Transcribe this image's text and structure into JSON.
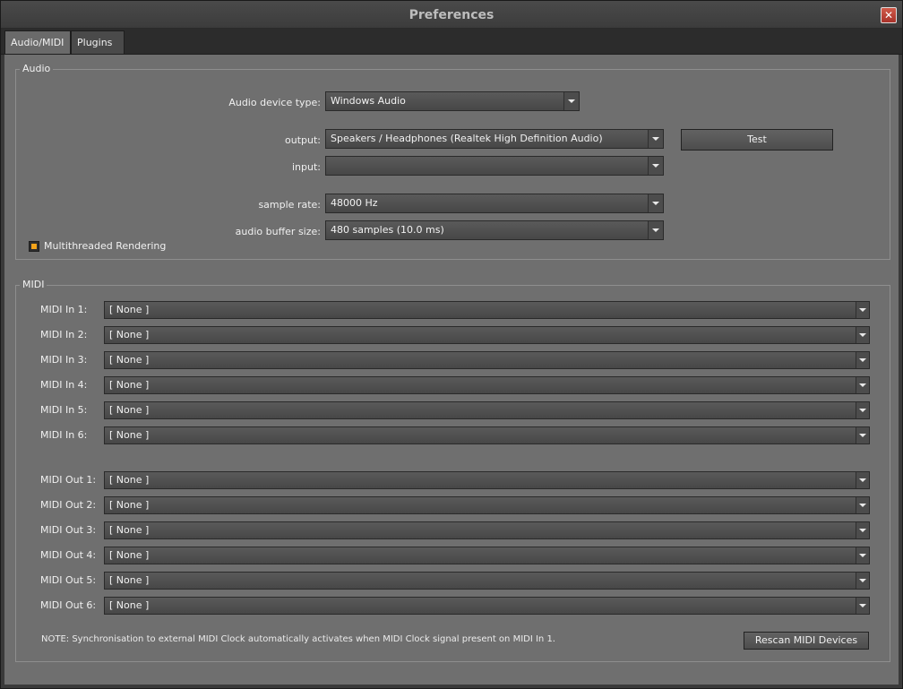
{
  "window": {
    "title": "Preferences",
    "close_glyph": "✕"
  },
  "tabs": [
    {
      "label": "Audio/MIDI",
      "active": true
    },
    {
      "label": "Plugins",
      "active": false
    }
  ],
  "audio": {
    "group_label": "Audio",
    "device_type_label": "Audio device type:",
    "device_type_value": "Windows Audio",
    "output_label": "output:",
    "output_value": "Speakers / Headphones (Realtek High Definition Audio)",
    "test_label": "Test",
    "input_label": "input:",
    "input_value": "",
    "sample_rate_label": "sample rate:",
    "sample_rate_value": "48000 Hz",
    "buffer_label": "audio buffer size:",
    "buffer_value": "480 samples (10.0 ms)",
    "multithread_label": "Multithreaded Rendering",
    "multithread_checked": true,
    "accent_color": "#f2a31a"
  },
  "midi": {
    "group_label": "MIDI",
    "inputs": [
      {
        "label": "MIDI In 1:",
        "value": "[ None ]"
      },
      {
        "label": "MIDI In 2:",
        "value": "[ None ]"
      },
      {
        "label": "MIDI In 3:",
        "value": "[ None ]"
      },
      {
        "label": "MIDI In 4:",
        "value": "[ None ]"
      },
      {
        "label": "MIDI In 5:",
        "value": "[ None ]"
      },
      {
        "label": "MIDI In 6:",
        "value": "[ None ]"
      }
    ],
    "outputs": [
      {
        "label": "MIDI Out 1:",
        "value": "[ None ]"
      },
      {
        "label": "MIDI Out 2:",
        "value": "[ None ]"
      },
      {
        "label": "MIDI Out 3:",
        "value": "[ None ]"
      },
      {
        "label": "MIDI Out 4:",
        "value": "[ None ]"
      },
      {
        "label": "MIDI Out 5:",
        "value": "[ None ]"
      },
      {
        "label": "MIDI Out 6:",
        "value": "[ None ]"
      }
    ],
    "note": "NOTE: Synchronisation to external MIDI Clock automatically activates when MIDI Clock signal present on MIDI In 1.",
    "rescan_label": "Rescan MIDI Devices"
  },
  "icons": {
    "close": "close-icon",
    "dropdown": "chevron-down-icon",
    "checkbox": "checkbox-icon"
  }
}
